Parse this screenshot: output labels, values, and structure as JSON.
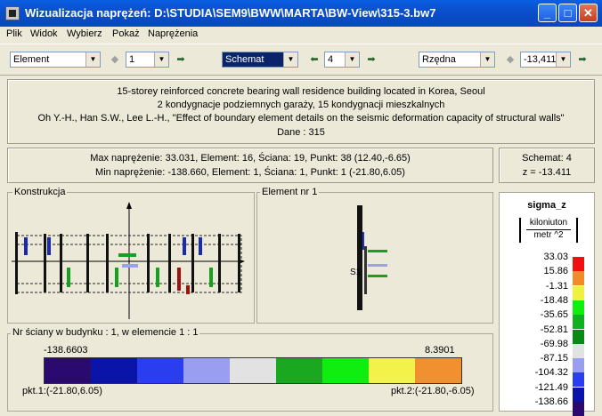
{
  "window": {
    "title": "Wizualizacja naprężeń: D:\\STUDIA\\SEM9\\BWW\\MARTA\\BW-View\\315-3.bw7",
    "minimize": "_",
    "maximize": "□",
    "close": "✕"
  },
  "menu": [
    "Plik",
    "Widok",
    "Wybierz",
    "Pokaż",
    "Naprężenia"
  ],
  "toolbar": {
    "element_combo": "Element",
    "element_value": "1",
    "schemat_combo": "Schemat",
    "schemat_value": "4",
    "rzedna_combo": "Rzędna",
    "rzedna_value": "-13,411"
  },
  "info": {
    "line1": "15-storey reinforced concrete bearing wall residence building located in Korea, Seoul",
    "line2": "2 kondygnacje podziemnych garaży, 15 kondygnacji mieszkalnych",
    "line3": "Oh Y.-H., Han S.W., Lee L.-H., \"Effect of boundary element details on the seismic deformation capacity of structural walls\"",
    "line4": "Dane :   315"
  },
  "stress": {
    "max": "Max naprężenie: 33.031,   Element: 16,   Ściana: 19,   Punkt: 38 (12.40,-6.65)",
    "min": "Min naprężenie: -138.660,   Element: 1,   Ściana: 1,   Punkt: 1 (-21.80,6.05)"
  },
  "schemat_info": {
    "schemat": "Schemat: 4",
    "z": "z = -13.411"
  },
  "konstrukcja": {
    "label": "Konstrukcja"
  },
  "element_panel": {
    "label": "Element nr 1",
    "marker": "S1"
  },
  "wall_info": {
    "label": "Nr ściany w budynku :  1,   w elemencie 1 :  1",
    "min_value": "-138.6603",
    "max_value": "8.3901",
    "pkt1": "pkt.1:(-21.80,6.05)",
    "pkt2": "pkt.2:(-21.80,-6.05)",
    "bar_colors": [
      "#2a0a6e",
      "#0a14a8",
      "#2a3ef0",
      "#9a9ef0",
      "#e2e2e2",
      "#19a81f",
      "#10ee10",
      "#f2f24a",
      "#f0902f"
    ]
  },
  "legend": {
    "title": "sigma_z",
    "unit_top": "kiloniuton",
    "unit_bottom": "metr ^2",
    "values": [
      "33.03",
      "15.86",
      "-1.31",
      "-18.48",
      "-35.65",
      "-52.81",
      "-69.98",
      "-87.15",
      "-104.32",
      "-121.49",
      "-138.66"
    ],
    "colors": [
      "#f01010",
      "#f08a2a",
      "#f0f040",
      "#10ee10",
      "#12b020",
      "#0a8a14",
      "#e2e2e2",
      "#9a9ef0",
      "#2a3ef0",
      "#0a14a8",
      "#2a0a6e"
    ]
  }
}
